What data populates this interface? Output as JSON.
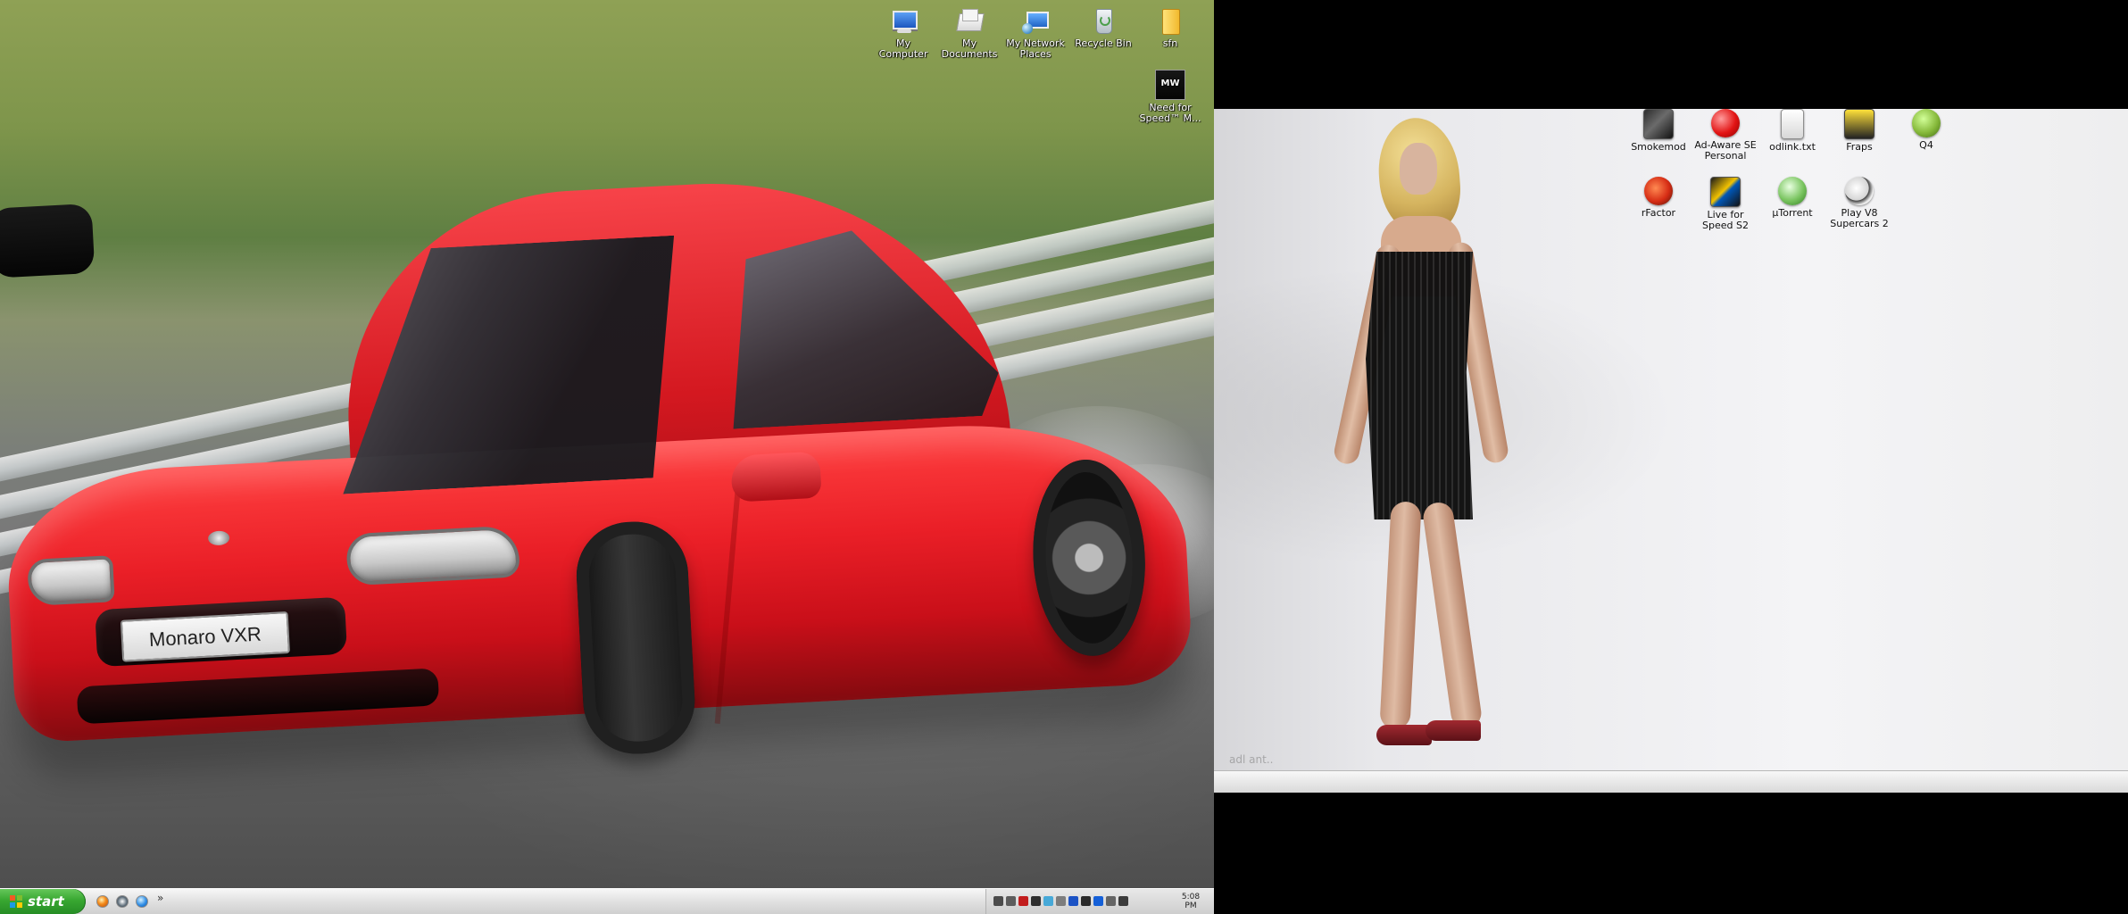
{
  "left_monitor": {
    "wallpaper": {
      "plate_text": "Monaro VXR"
    },
    "desktop_icons": [
      {
        "label": "My Computer",
        "icon": "computer-icon"
      },
      {
        "label": "My Documents",
        "icon": "documents-icon"
      },
      {
        "label": "My Network Places",
        "icon": "network-icon"
      },
      {
        "label": "Recycle Bin",
        "icon": "recycle-bin-icon"
      },
      {
        "label": "sfn",
        "icon": "folder-icon"
      },
      {
        "label": "Need for Speed™ M...",
        "icon": "need-for-speed-icon",
        "icon_text": "MW"
      }
    ],
    "taskbar": {
      "start_label": "start",
      "overflow_label": "»",
      "clock": "5:08 PM",
      "quick_launch": [
        {
          "icon": "firefox-icon"
        },
        {
          "icon": "media-player-icon"
        },
        {
          "icon": "internet-explorer-icon"
        }
      ],
      "tray_icons": [
        {
          "icon": "volume-icon",
          "color": "#4c4c4c"
        },
        {
          "icon": "network-tray-icon",
          "color": "#5d5d5d"
        },
        {
          "icon": "security-icon",
          "color": "#c21d1d"
        },
        {
          "icon": "antivirus-icon",
          "color": "#2f2f2f"
        },
        {
          "icon": "update-icon",
          "color": "#47a9d8"
        },
        {
          "icon": "tool-icon",
          "color": "#7d7d7d"
        },
        {
          "icon": "bluetooth-icon",
          "color": "#1c53c5"
        },
        {
          "icon": "display-icon",
          "color": "#2b2b2b"
        },
        {
          "icon": "vpn-icon",
          "color": "#1560d8"
        },
        {
          "icon": "settings-tray-icon",
          "color": "#656565"
        },
        {
          "icon": "speaker-icon",
          "color": "#3b3b3b"
        }
      ]
    }
  },
  "right_monitor": {
    "watermark": "adl ant..",
    "desktop_icons": [
      {
        "label": "Smokemod",
        "icon": "smokemod-icon"
      },
      {
        "label": "Ad-Aware SE Personal",
        "icon": "adaware-icon"
      },
      {
        "label": "odlink.txt",
        "icon": "text-file-icon"
      },
      {
        "label": "Fraps",
        "icon": "fraps-icon"
      },
      {
        "label": "Q4",
        "icon": "q4-icon"
      },
      {
        "label": "rFactor",
        "icon": "rfactor-icon"
      },
      {
        "label": "Live for Speed S2",
        "icon": "live-for-speed-icon"
      },
      {
        "label": "µTorrent",
        "icon": "utorrent-icon"
      },
      {
        "label": "Play V8 Supercars 2",
        "icon": "v8-supercars-icon"
      }
    ]
  }
}
